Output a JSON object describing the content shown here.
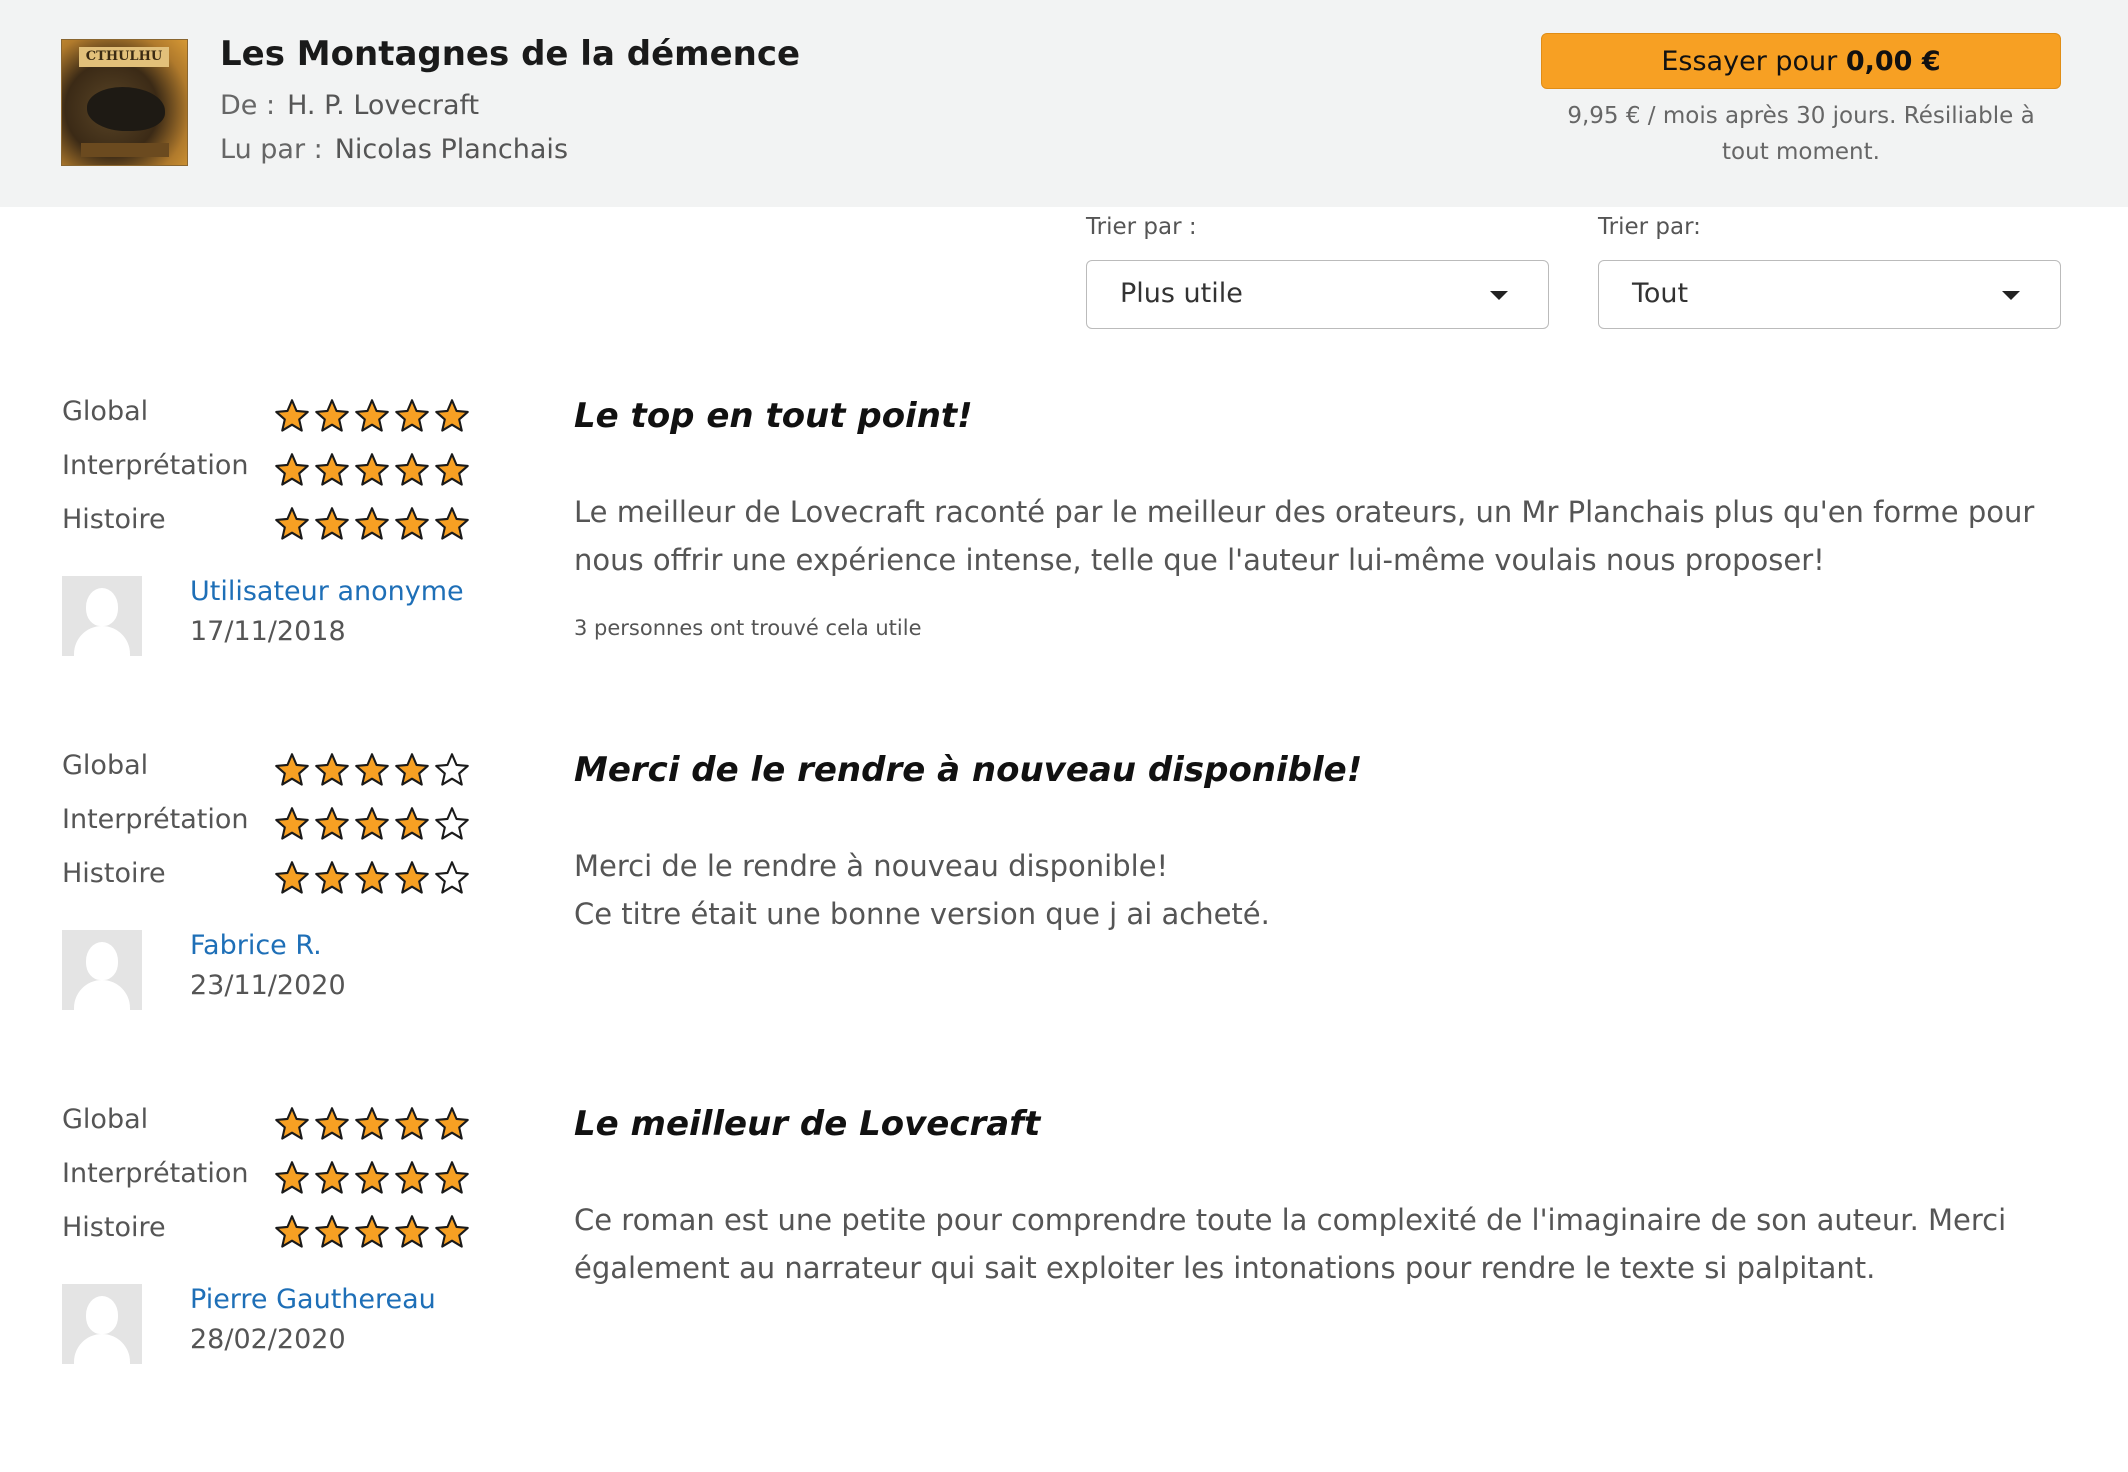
{
  "book": {
    "title": "Les Montagnes de la démence",
    "author_label": "De :",
    "author": "H. P. Lovecraft",
    "narrator_label": "Lu par :",
    "narrator": "Nicolas Planchais",
    "cover_text": "CTHULHU"
  },
  "offer": {
    "button_prefix": "Essayer pour ",
    "button_price": "0,00 €",
    "subtext": "9,95 € / mois après 30 jours. Résiliable à tout moment."
  },
  "sort": {
    "order_label": "Trier par :",
    "order_value": "Plus utile",
    "filter_label": "Trier par:",
    "filter_value": "Tout"
  },
  "rating_labels": {
    "global": "Global",
    "interpretation": "Interprétation",
    "story": "Histoire"
  },
  "reviews": [
    {
      "ratings": {
        "global": 5,
        "interpretation": 5,
        "story": 5
      },
      "author": "Utilisateur anonyme",
      "date": "17/11/2018",
      "title": "Le top en tout point!",
      "body": "Le meilleur de Lovecraft raconté par le meilleur des orateurs, un Mr Planchais plus qu'en forme pour nous offrir une expérience intense, telle que l'auteur lui-même voulais nous proposer!",
      "helpful": "3 personnes ont trouvé cela utile"
    },
    {
      "ratings": {
        "global": 4,
        "interpretation": 4,
        "story": 4
      },
      "author": "Fabrice R.",
      "date": "23/11/2020",
      "title": "Merci de le rendre à nouveau disponible!",
      "body_lines": [
        "Merci de le rendre à nouveau disponible!",
        "Ce titre était une bonne version que j ai acheté."
      ]
    },
    {
      "ratings": {
        "global": 5,
        "interpretation": 5,
        "story": 5
      },
      "author": "Pierre Gauthereau",
      "date": "28/02/2020",
      "title": "Le meilleur de Lovecraft",
      "body": "Ce roman est une petite pour comprendre toute la complexité de l'imaginaire de son auteur. Merci également au narrateur qui sait exploiter les intonations pour rendre le texte si palpitant."
    }
  ],
  "colors": {
    "star_fill": "#f7a023",
    "star_stroke": "#1a1a1a",
    "accent": "#f7a023",
    "link": "#1e6fb7",
    "header_bg": "#f2f3f3"
  }
}
